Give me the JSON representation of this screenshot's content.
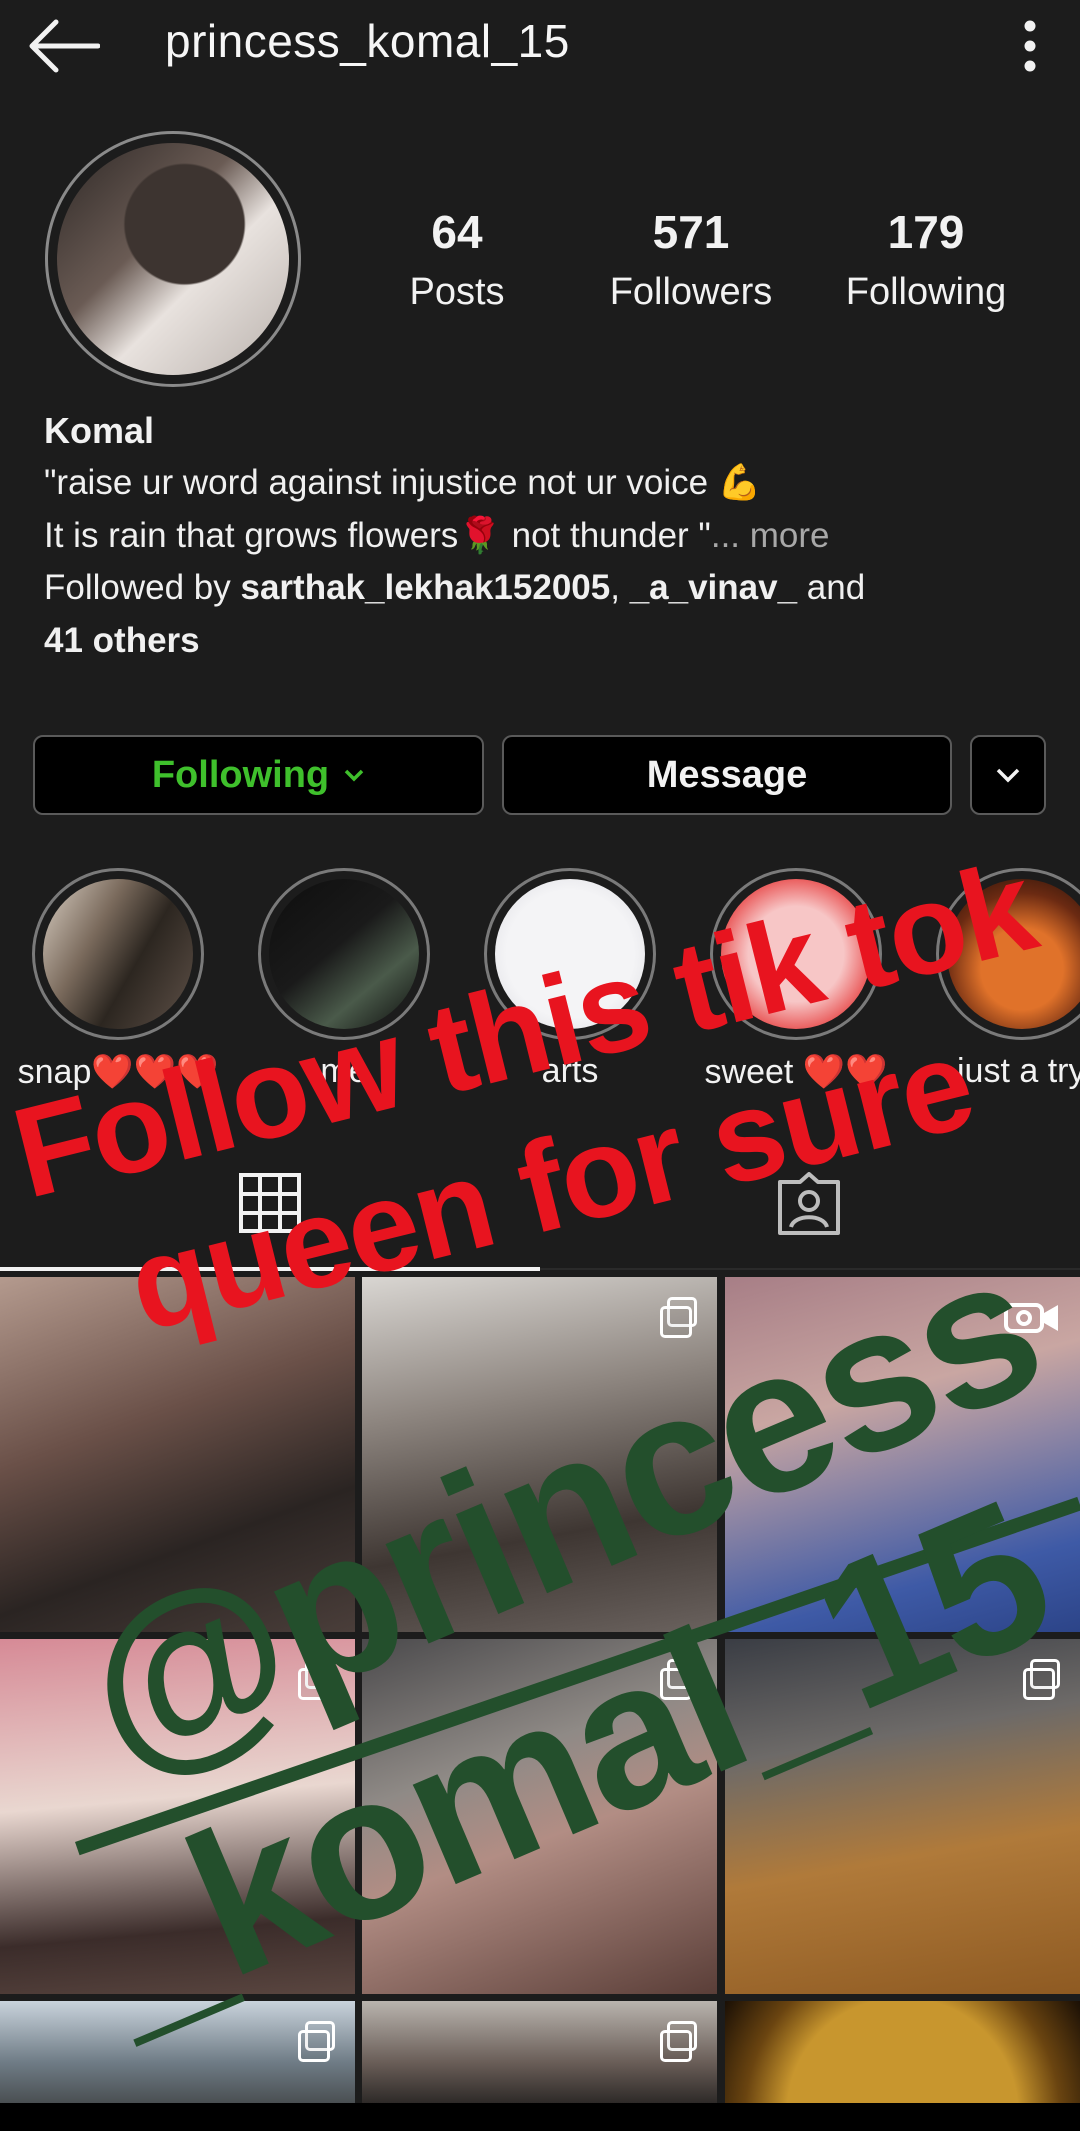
{
  "header": {
    "username": "princess_komal_15"
  },
  "profile": {
    "stats": [
      {
        "value": "64",
        "label": "Posts"
      },
      {
        "value": "571",
        "label": "Followers"
      },
      {
        "value": "179",
        "label": "Following"
      }
    ],
    "full_name": "Komal",
    "bio_line1": "\"raise ur word against injustice not ur voice 💪",
    "bio_line2_a": "It is rain that grows flowers🌹  not thunder \"",
    "bio_more": "... more",
    "followed_by_prefix": "Followed by ",
    "followed_by_user1": "sarthak_lekhak152005",
    "followed_by_sep": ", ",
    "followed_by_user2": "_a_vinav_",
    "followed_by_and": " and",
    "followed_by_others": "41 others"
  },
  "actions": {
    "following": "Following",
    "message": "Message"
  },
  "highlights": [
    {
      "label": "snap❤️❤️❤️"
    },
    {
      "label": "me"
    },
    {
      "label": "arts"
    },
    {
      "label": "sweet ❤️❤️"
    },
    {
      "label": "just a try"
    }
  ],
  "overlay": {
    "red_line1": "Follow this tik tok",
    "red_line2": "queen for sure",
    "green_line1": "@princess",
    "green_line2": "_komal_15",
    "red_color": "#e8141f",
    "green_color": "#234f2c"
  },
  "colors": {
    "background": "#1c1c1c",
    "following_green": "#3fc02c"
  },
  "icons": [
    "back-arrow-icon",
    "more-vertical-icon",
    "chevron-down-icon",
    "grid-icon",
    "tagged-icon",
    "reel-icon",
    "multiple-posts-icon"
  ]
}
